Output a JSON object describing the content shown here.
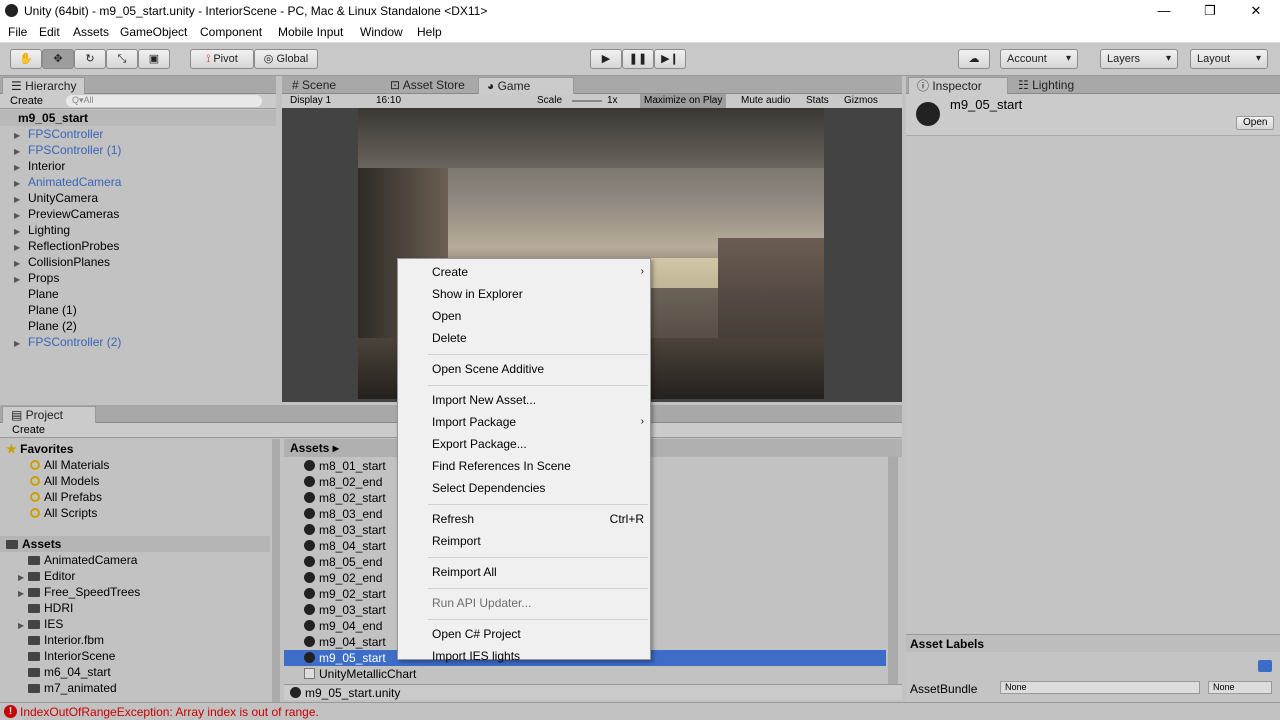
{
  "window": {
    "title": "Unity (64bit) - m9_05_start.unity - InteriorScene - PC, Mac & Linux Standalone <DX11>",
    "minimize": "—",
    "maximize": "❐",
    "close": "✕"
  },
  "menubar": [
    "File",
    "Edit",
    "Assets",
    "GameObject",
    "Component",
    "Mobile Input",
    "Window",
    "Help"
  ],
  "toolbar": {
    "pivot": "Pivot",
    "global": "Global",
    "account": "Account",
    "layers": "Layers",
    "layout": "Layout"
  },
  "hierarchy": {
    "tab": "Hierarchy",
    "create": "Create",
    "search_placeholder": "Q▾All",
    "scene": "m9_05_start",
    "items": [
      {
        "label": "FPSController",
        "blue": true,
        "arrow": true
      },
      {
        "label": "FPSController (1)",
        "blue": true,
        "arrow": true
      },
      {
        "label": "Interior",
        "blue": false,
        "arrow": true
      },
      {
        "label": "AnimatedCamera",
        "blue": true,
        "arrow": true
      },
      {
        "label": "UnityCamera",
        "blue": false,
        "arrow": true
      },
      {
        "label": "PreviewCameras",
        "blue": false,
        "arrow": true
      },
      {
        "label": "Lighting",
        "blue": false,
        "arrow": true
      },
      {
        "label": "ReflectionProbes",
        "blue": false,
        "arrow": true
      },
      {
        "label": "CollisionPlanes",
        "blue": false,
        "arrow": true
      },
      {
        "label": "Props",
        "blue": false,
        "arrow": true
      },
      {
        "label": "Plane",
        "blue": false,
        "arrow": false
      },
      {
        "label": "Plane (1)",
        "blue": false,
        "arrow": false
      },
      {
        "label": "Plane (2)",
        "blue": false,
        "arrow": false
      },
      {
        "label": "FPSController (2)",
        "blue": true,
        "arrow": true
      }
    ]
  },
  "center_tabs": {
    "scene": "Scene",
    "asset_store": "Asset Store",
    "game": "Game"
  },
  "game_bar": {
    "display": "Display 1",
    "aspect": "16:10",
    "scale_label": "Scale",
    "scale_value": "1x",
    "maximize": "Maximize on Play",
    "mute": "Mute audio",
    "stats": "Stats",
    "gizmos": "Gizmos"
  },
  "inspector": {
    "tab": "Inspector",
    "lighting_tab": "Lighting",
    "object": "m9_05_start",
    "open": "Open",
    "asset_labels": "Asset Labels",
    "asset_bundle": "AssetBundle",
    "bundle_value": "None",
    "variant_value": "None"
  },
  "project": {
    "tab": "Project",
    "create": "Create",
    "favorites": "Favorites",
    "fav_items": [
      "All Materials",
      "All Models",
      "All Prefabs",
      "All Scripts"
    ],
    "assets_root": "Assets",
    "folders": [
      {
        "label": "AnimatedCamera",
        "arrow": false
      },
      {
        "label": "Editor",
        "arrow": true
      },
      {
        "label": "Free_SpeedTrees",
        "arrow": true
      },
      {
        "label": "HDRI",
        "arrow": false
      },
      {
        "label": "IES",
        "arrow": true
      },
      {
        "label": "Interior.fbm",
        "arrow": false
      },
      {
        "label": "InteriorScene",
        "arrow": false
      },
      {
        "label": "m6_04_start",
        "arrow": false
      },
      {
        "label": "m7_animated",
        "arrow": false
      }
    ],
    "breadcrumb": "Assets ▸",
    "files": [
      "m8_01_start",
      "m8_02_end",
      "m8_02_start",
      "m8_03_end",
      "m8_03_start",
      "m8_04_start",
      "m8_05_end",
      "m9_02_end",
      "m9_02_start",
      "m9_03_start",
      "m9_04_end",
      "m9_04_start",
      "m9_05_start",
      "UnityMetallicChart"
    ],
    "selected_file": "m9_05_start",
    "footer_file": "m9_05_start.unity"
  },
  "context_menu": {
    "items": [
      {
        "label": "Create",
        "sub": true,
        "shortcut": "",
        "disabled": false
      },
      {
        "label": "Show in Explorer",
        "sub": false,
        "shortcut": "",
        "disabled": false
      },
      {
        "label": "Open",
        "sub": false,
        "shortcut": "",
        "disabled": false
      },
      {
        "label": "Delete",
        "sub": false,
        "shortcut": "",
        "disabled": false
      },
      {
        "sep": true
      },
      {
        "label": "Open Scene Additive",
        "sub": false,
        "shortcut": "",
        "disabled": false
      },
      {
        "sep": true
      },
      {
        "label": "Import New Asset...",
        "sub": false,
        "shortcut": "",
        "disabled": false
      },
      {
        "label": "Import Package",
        "sub": true,
        "shortcut": "",
        "disabled": false
      },
      {
        "label": "Export Package...",
        "sub": false,
        "shortcut": "",
        "disabled": false
      },
      {
        "label": "Find References In Scene",
        "sub": false,
        "shortcut": "",
        "disabled": false
      },
      {
        "label": "Select Dependencies",
        "sub": false,
        "shortcut": "",
        "disabled": false
      },
      {
        "sep": true
      },
      {
        "label": "Refresh",
        "sub": false,
        "shortcut": "Ctrl+R",
        "disabled": false
      },
      {
        "label": "Reimport",
        "sub": false,
        "shortcut": "",
        "disabled": false
      },
      {
        "sep": true
      },
      {
        "label": "Reimport All",
        "sub": false,
        "shortcut": "",
        "disabled": false
      },
      {
        "sep": true
      },
      {
        "label": "Run API Updater...",
        "sub": false,
        "shortcut": "",
        "disabled": true
      },
      {
        "sep": true
      },
      {
        "label": "Open C# Project",
        "sub": false,
        "shortcut": "",
        "disabled": false
      },
      {
        "label": "Import IES lights",
        "sub": false,
        "shortcut": "",
        "disabled": false
      }
    ]
  },
  "status": {
    "message": "IndexOutOfRangeException: Array index is out of range.",
    "color": "#c80000"
  }
}
